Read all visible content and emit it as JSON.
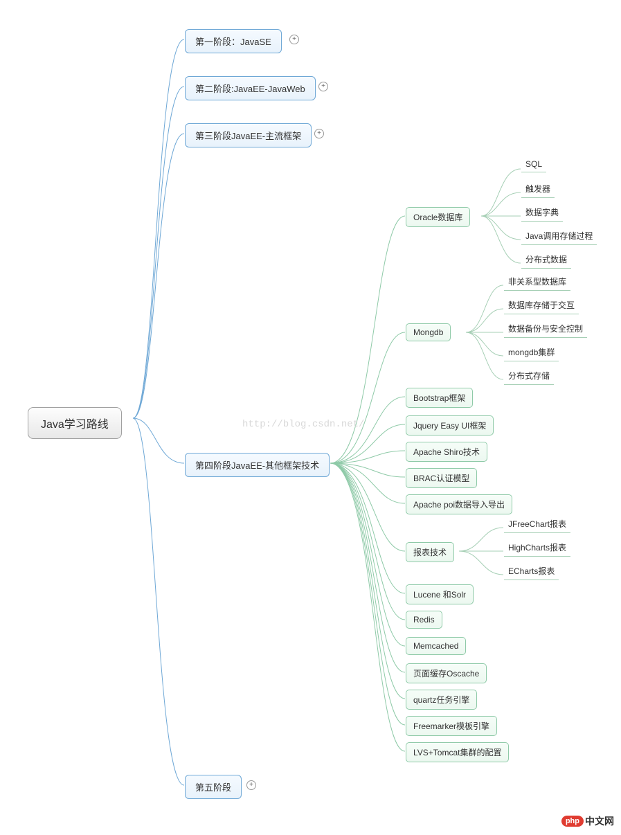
{
  "root": {
    "label": "Java学习路线"
  },
  "stage1": {
    "label": "第一阶段：JavaSE"
  },
  "stage2": {
    "label": "第二阶段:JavaEE-JavaWeb"
  },
  "stage3": {
    "label": "第三阶段JavaEE-主流框架"
  },
  "stage4": {
    "label": "第四阶段JavaEE-其他框架技术"
  },
  "stage5": {
    "label": "第五阶段"
  },
  "s4": {
    "oracle": {
      "label": "Oracle数据库"
    },
    "oracle_children": {
      "c1": "SQL",
      "c2": "触发器",
      "c3": "数据字典",
      "c4": "Java调用存储过程",
      "c5": "分布式数据"
    },
    "mongdb": {
      "label": "Mongdb"
    },
    "mongdb_children": {
      "c1": "非关系型数据库",
      "c2": "数据库存储于交互",
      "c3": "数据备份与安全控制",
      "c4": "mongdb集群",
      "c5": "分布式存储"
    },
    "bootstrap": "Bootstrap框架",
    "jquery": "Jquery Easy UI框架",
    "shiro": "Apache Shiro技术",
    "brac": "BRAC认证模型",
    "poi": "Apache poi数据导入导出",
    "report": {
      "label": "报表技术"
    },
    "report_children": {
      "c1": "JFreeChart报表",
      "c2": "HighCharts报表",
      "c3": "ECharts报表"
    },
    "lucene": "Lucene 和Solr",
    "redis": "Redis",
    "memcached": "Memcached",
    "oscache": "页面缓存Oscache",
    "quartz": "quartz任务引擎",
    "freemarker": "Freemarker模板引擎",
    "lvs": "LVS+Tomcat集群的配置"
  },
  "watermark": "http://blog.csdn.net/",
  "logo": {
    "badge": "php",
    "text": "中文网"
  }
}
